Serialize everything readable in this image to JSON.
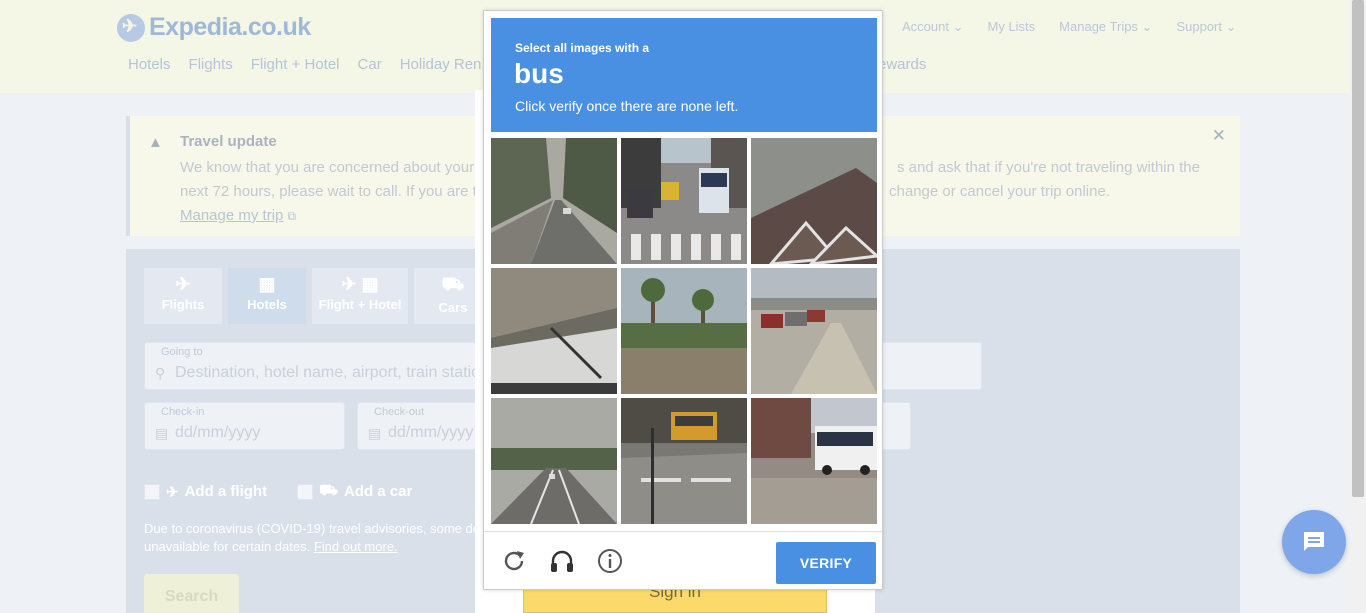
{
  "header": {
    "logo_text": "Expedia.co.uk",
    "nav_primary": [
      "Hotels",
      "Flights",
      "Flight + Hotel",
      "Car",
      "Holiday Ren"
    ],
    "nav_rewards": "ewards",
    "nav_right": [
      "Account",
      "My Lists",
      "Manage Trips",
      "Support"
    ]
  },
  "alert": {
    "title": "Travel update",
    "body_left_1": "We know that you are concerned about your",
    "body_right_1": "s and ask that if you're not traveling within the",
    "body_left_2": "next 72 hours, please wait to call. If you are t",
    "body_right_2": "change or cancel your trip online.",
    "link": "Manage my trip"
  },
  "search": {
    "tabs": [
      "Flights",
      "Hotels",
      "Flight + Hotel",
      "Cars"
    ],
    "going_to_label": "Going to",
    "going_to_placeholder": "Destination, hotel name, airport, train statio",
    "checkin_label": "Check-in",
    "checkin_placeholder": "dd/mm/yyyy",
    "checkout_label": "Check-out",
    "checkout_placeholder": "dd/mm/yyyy",
    "add_flight": "Add a flight",
    "add_car": "Add a car",
    "covid_text": "Due to coronavirus (COVID-19) travel advisories, some de unavailable for certain dates.",
    "covid_link": "Find out more.",
    "search_button": "Search"
  },
  "modal": {
    "signin_button": "Sign in"
  },
  "captcha": {
    "line1": "Select all images with a",
    "target": "bus",
    "line3": "Click verify once there are none left.",
    "verify_button": "VERIFY",
    "tiles": [
      "road-trees",
      "street-bus",
      "house-roof",
      "car-hood",
      "palm-trees",
      "parked-cars",
      "highway",
      "school-bus-street",
      "white-bus"
    ]
  },
  "colors": {
    "captcha_blue": "#4a90e2",
    "chat_bubble": "#7fa6e8",
    "signin_yellow": "#fbd96b"
  }
}
